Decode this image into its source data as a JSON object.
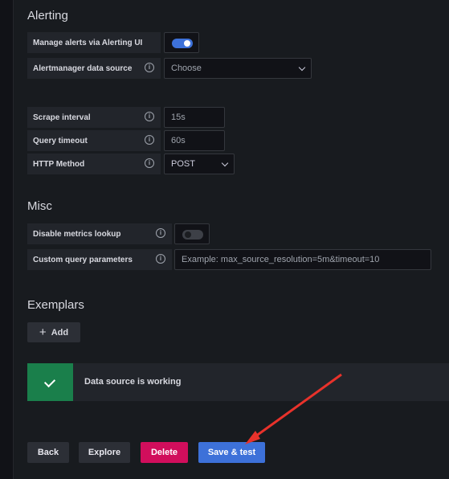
{
  "alerting": {
    "title": "Alerting",
    "manage_alerts": {
      "label": "Manage alerts via Alerting UI",
      "enabled": true
    },
    "alertmanager": {
      "label": "Alertmanager data source",
      "value": "Choose"
    }
  },
  "http": {
    "scrape_interval": {
      "label": "Scrape interval",
      "placeholder": "15s"
    },
    "query_timeout": {
      "label": "Query timeout",
      "placeholder": "60s"
    },
    "http_method": {
      "label": "HTTP Method",
      "value": "POST"
    }
  },
  "misc": {
    "title": "Misc",
    "disable_metrics_lookup": {
      "label": "Disable metrics lookup",
      "enabled": false
    },
    "custom_query_params": {
      "label": "Custom query parameters",
      "placeholder": "Example: max_source_resolution=5m&timeout=10"
    }
  },
  "exemplars": {
    "title": "Exemplars",
    "add_label": "Add"
  },
  "status": {
    "message": "Data source is working",
    "color": "#1a7f4b"
  },
  "actions": {
    "back": "Back",
    "explore": "Explore",
    "delete": "Delete",
    "save_test": "Save & test"
  },
  "icons": {
    "info": "info-icon",
    "plus": "plus-icon",
    "check": "check-icon",
    "chevron": "chevron-down-icon"
  },
  "colors": {
    "primary": "#3d71d9",
    "danger": "#d10e5c",
    "success": "#1a7f4b",
    "annotation_arrow": "#e8322b"
  }
}
